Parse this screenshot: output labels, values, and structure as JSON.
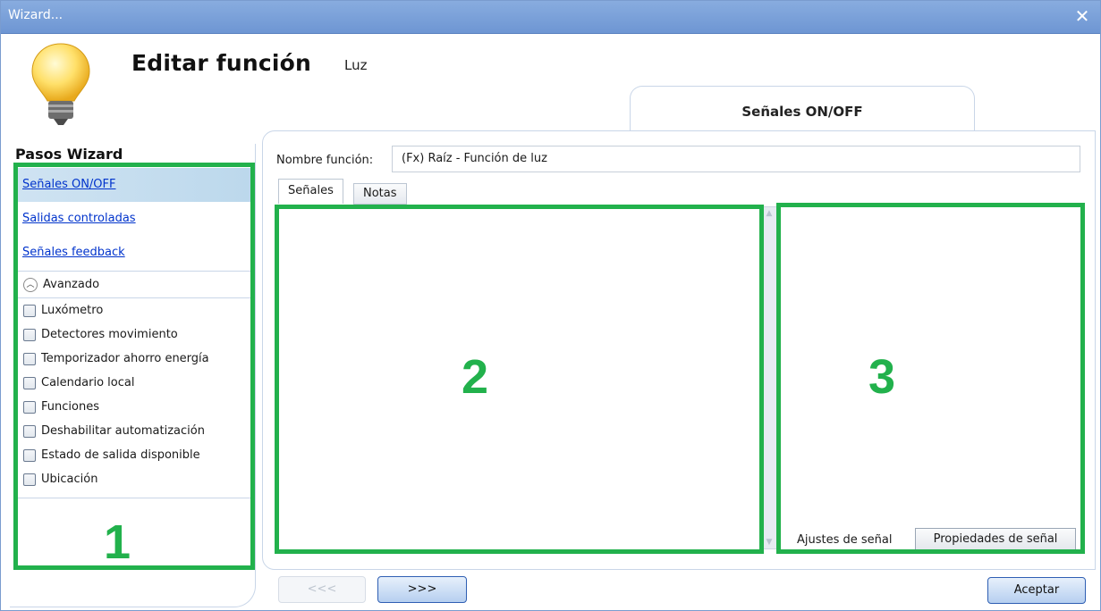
{
  "window": {
    "title": "Wizard..."
  },
  "header": {
    "title": "Editar función",
    "subtitle": "Luz",
    "current_step": "Señales ON/OFF"
  },
  "sidebar": {
    "title": "Pasos Wizard",
    "steps": [
      {
        "label": "Señales ON/OFF",
        "active": true
      },
      {
        "label": "Salidas controladas",
        "active": false
      },
      {
        "label": "Señales feedback",
        "active": false
      }
    ],
    "advanced": {
      "label": "Avanzado",
      "items": [
        {
          "label": "Luxómetro",
          "checked": false
        },
        {
          "label": "Detectores movimiento",
          "checked": false
        },
        {
          "label": "Temporizador ahorro energía",
          "checked": false
        },
        {
          "label": "Calendario local",
          "checked": false
        },
        {
          "label": "Funciones",
          "checked": false
        },
        {
          "label": "Deshabilitar automatización",
          "checked": false
        },
        {
          "label": "Estado de salida disponible",
          "checked": false
        },
        {
          "label": "Ubicación",
          "checked": false
        }
      ]
    }
  },
  "main": {
    "name_label": "Nombre función:",
    "name_value": "(Fx) Raíz - Función de luz",
    "tabs": [
      {
        "label": "Señales"
      },
      {
        "label": "Notas"
      }
    ],
    "signal_tabs": {
      "settings": "Ajustes de señal",
      "properties": "Propiedades de señal"
    }
  },
  "annotations": {
    "region1": "1",
    "region2": "2",
    "region3": "3",
    "color": "#22b14c"
  },
  "buttons": {
    "prev": "<<<",
    "next": ">>>",
    "ok": "Aceptar"
  }
}
